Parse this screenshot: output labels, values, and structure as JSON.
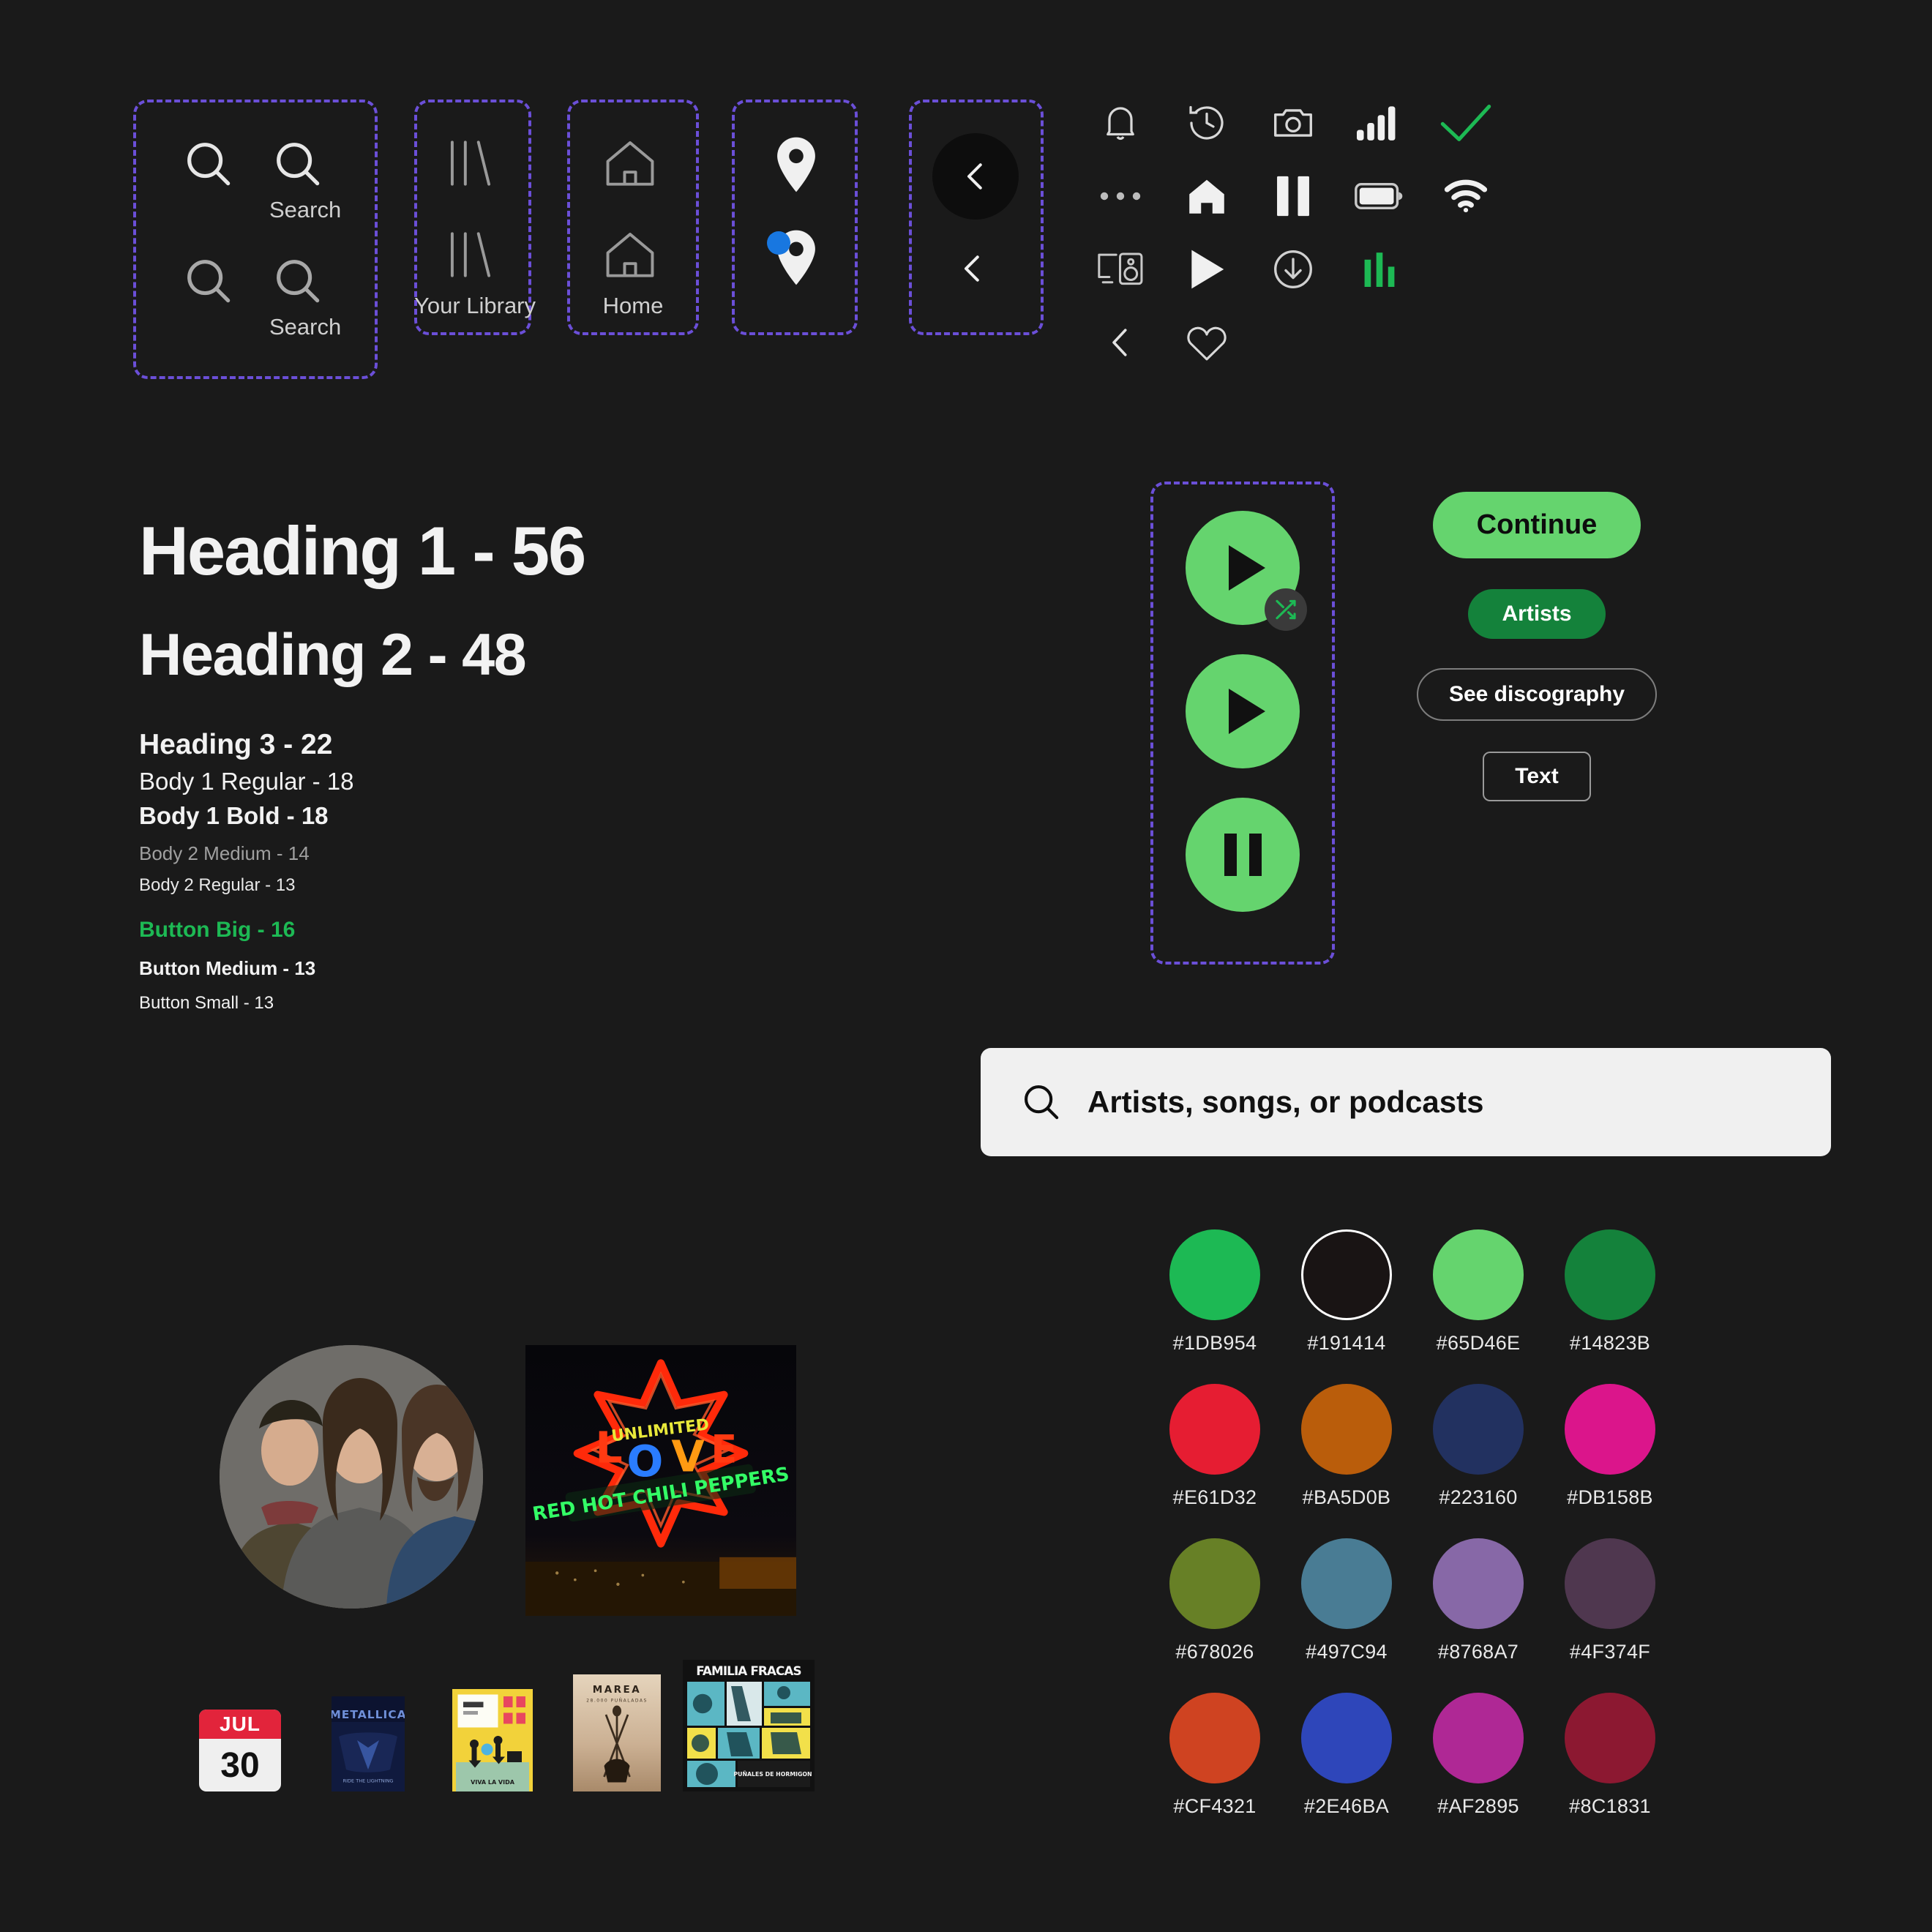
{
  "nav_boxes": {
    "search": {
      "label_1": "Search",
      "label_2": "Search",
      "icon": "search-icon"
    },
    "library": {
      "label": "Your Library",
      "icon": "library-icon"
    },
    "home": {
      "label": "Home",
      "icon": "home-outline-icon"
    },
    "pin": {
      "icon": "location-pin-icon",
      "icon_variant": "location-pin-with-dot-icon",
      "dot_color": "#1877e0"
    },
    "back": {
      "icon": "chevron-left-icon",
      "icon_variant": "chevron-left-circle-icon"
    }
  },
  "icon_grid": [
    {
      "name": "bell-icon"
    },
    {
      "name": "clock-history-icon"
    },
    {
      "name": "camera-icon"
    },
    {
      "name": "signal-bars-icon"
    },
    {
      "name": "check-icon"
    },
    {
      "name": "more-dots-icon"
    },
    {
      "name": "home-filled-icon"
    },
    {
      "name": "pause-icon"
    },
    {
      "name": "battery-icon"
    },
    {
      "name": "wifi-icon"
    },
    {
      "name": "cast-speaker-icon"
    },
    {
      "name": "play-icon"
    },
    {
      "name": "download-circle-icon"
    },
    {
      "name": "equalizer-bars-icon"
    },
    {
      "name": "chevron-left-icon"
    },
    {
      "name": "heart-icon"
    }
  ],
  "typography": {
    "h1": "Heading 1 - 56",
    "h2": "Heading 2 - 48",
    "h3": "Heading 3 - 22",
    "body1_regular": "Body 1 Regular - 18",
    "body1_bold": "Body 1 Bold - 18",
    "body2_medium": "Body 2 Medium - 14",
    "body2_regular": "Body 2 Regular - 13",
    "button_big": "Button Big - 16",
    "button_medium": "Button Medium - 13",
    "button_small": "Button Small - 13"
  },
  "play_stack": {
    "play_shuffle": {
      "icon": "play-icon",
      "badge_icon": "shuffle-icon"
    },
    "play": {
      "icon": "play-icon"
    },
    "pause": {
      "icon": "pause-icon"
    },
    "fill_color": "#65D46E"
  },
  "buttons": {
    "continue": "Continue",
    "artists": "Artists",
    "see_discography": "See discography",
    "text": "Text"
  },
  "search_field": {
    "placeholder": "Artists, songs, or podcasts",
    "icon": "search-icon"
  },
  "swatches": [
    {
      "hex": "#1DB954",
      "color": "#1DB954",
      "outlined": false
    },
    {
      "hex": "#191414",
      "color": "#191414",
      "outlined": true
    },
    {
      "hex": "#65D46E",
      "color": "#65D46E",
      "outlined": false
    },
    {
      "hex": "#14823B",
      "color": "#14823B",
      "outlined": false
    },
    {
      "hex": "#E61D32",
      "color": "#E61D32",
      "outlined": false
    },
    {
      "hex": "#BA5D0B",
      "color": "#BA5D0B",
      "outlined": false
    },
    {
      "hex": "#223160",
      "color": "#223160",
      "outlined": false
    },
    {
      "hex": "#DB158B",
      "color": "#DB158B",
      "outlined": false
    },
    {
      "hex": "#678026",
      "color": "#678026",
      "outlined": false
    },
    {
      "hex": "#497C94",
      "color": "#497C94",
      "outlined": false
    },
    {
      "hex": "#8768A7",
      "color": "#8768A7",
      "outlined": false
    },
    {
      "hex": "#4F374F",
      "color": "#4F374F",
      "outlined": false
    },
    {
      "hex": "#CF4321",
      "color": "#CF4321",
      "outlined": false
    },
    {
      "hex": "#2E46BA",
      "color": "#2E46BA",
      "outlined": false
    },
    {
      "hex": "#AF2895",
      "color": "#AF2895",
      "outlined": false
    },
    {
      "hex": "#8C1831",
      "color": "#8C1831",
      "outlined": false
    }
  ],
  "imagery": {
    "avatar_alt": "band-photo-avatar",
    "album_alt": "red-hot-chili-peppers-unlimited-love-album-art",
    "album_text_1": "UNLIMITED",
    "album_text_2": "LOVE",
    "album_text_3": "RED HOT CHILI PEPPERS",
    "calendar": {
      "month": "JUL",
      "day": "30"
    },
    "thumbs": [
      {
        "alt": "metallica-album-thumb"
      },
      {
        "alt": "yellow-illustrated-album-thumb"
      },
      {
        "alt": "marea-album-thumb",
        "title": "MAREA"
      },
      {
        "alt": "familia-fracas-album-thumb",
        "title": "FAMILIA FRACAS"
      }
    ]
  },
  "theme": {
    "background": "#1A1A1A",
    "spec_border": "#6B4FD8",
    "accent_green": "#1DB954",
    "accent_light_green": "#65D46E"
  }
}
